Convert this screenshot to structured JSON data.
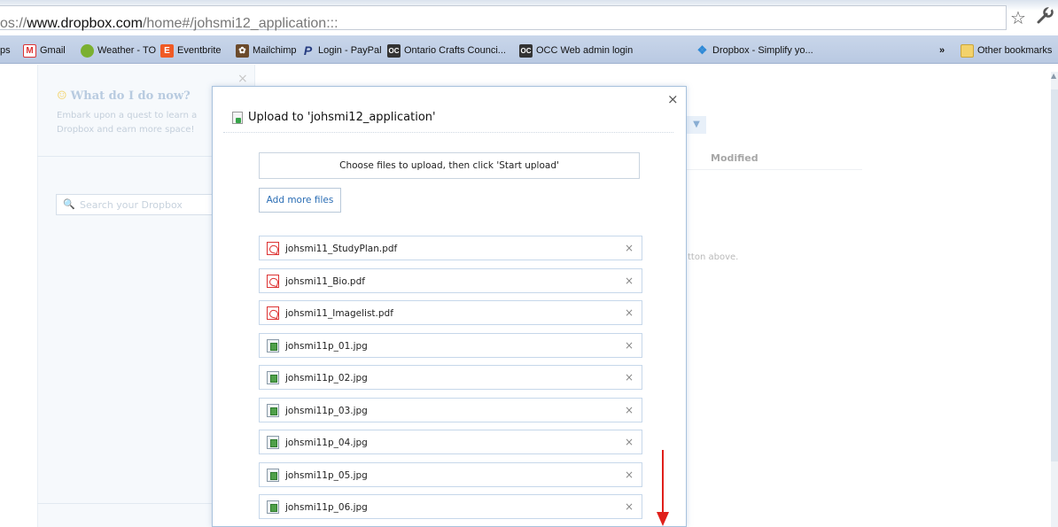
{
  "browser": {
    "url_prefix": "os://",
    "url_host": "www.dropbox.com",
    "url_path": "/home#/johsmi12_application:::",
    "bookmarks": [
      {
        "label": "ps",
        "icon": "apps-icon"
      },
      {
        "label": "Gmail",
        "icon": "gmail-icon",
        "color": "#d33"
      },
      {
        "label": "Weather - TO",
        "icon": "weather-icon",
        "color": "#7bb030"
      },
      {
        "label": "Eventbrite",
        "icon": "eventbrite-icon",
        "color": "#f05a24"
      },
      {
        "label": "Mailchimp",
        "icon": "mailchimp-icon",
        "color": "#333"
      },
      {
        "label": "Login - PayPal",
        "icon": "paypal-icon",
        "color": "#253b80"
      },
      {
        "label": "Ontario Crafts Counci...",
        "icon": "occ-icon",
        "color": "#333"
      },
      {
        "label": "OCC Web admin login",
        "icon": "occ-icon",
        "color": "#333"
      },
      {
        "label": "Dropbox - Simplify yo...",
        "icon": "dropbox-icon",
        "color": "#2e89d6"
      }
    ],
    "overflow": "»",
    "other_bookmarks": "Other bookmarks"
  },
  "page": {
    "what_heading": "What do I do now?",
    "embark_line1": "Embark upon a quest to learn a",
    "embark_line2": "Dropbox and earn more space!",
    "search_placeholder": "Search your Dropbox",
    "modified_header": "Modified",
    "hint_fragment": "tton above.",
    "dropdown_glyph": "▼"
  },
  "modal": {
    "title": "Upload to 'johsmi12_application'",
    "choose_text": "Choose files to upload, then click 'Start upload'",
    "add_more_label": "Add more files",
    "files": [
      {
        "name": "johsmi11_StudyPlan.pdf",
        "type": "pdf"
      },
      {
        "name": "johsmi11_Bio.pdf",
        "type": "pdf"
      },
      {
        "name": "johsmi11_Imagelist.pdf",
        "type": "pdf"
      },
      {
        "name": "johsmi11p_01.jpg",
        "type": "jpg"
      },
      {
        "name": "johsmi11p_02.jpg",
        "type": "jpg"
      },
      {
        "name": "johsmi11p_03.jpg",
        "type": "jpg"
      },
      {
        "name": "johsmi11p_04.jpg",
        "type": "jpg"
      },
      {
        "name": "johsmi11p_05.jpg",
        "type": "jpg"
      },
      {
        "name": "johsmi11p_06.jpg",
        "type": "jpg"
      }
    ],
    "remove_glyph": "×",
    "close_glyph": "×"
  },
  "colors": {
    "accent_link": "#2a6db4",
    "annotation_arrow": "#e0201b"
  }
}
